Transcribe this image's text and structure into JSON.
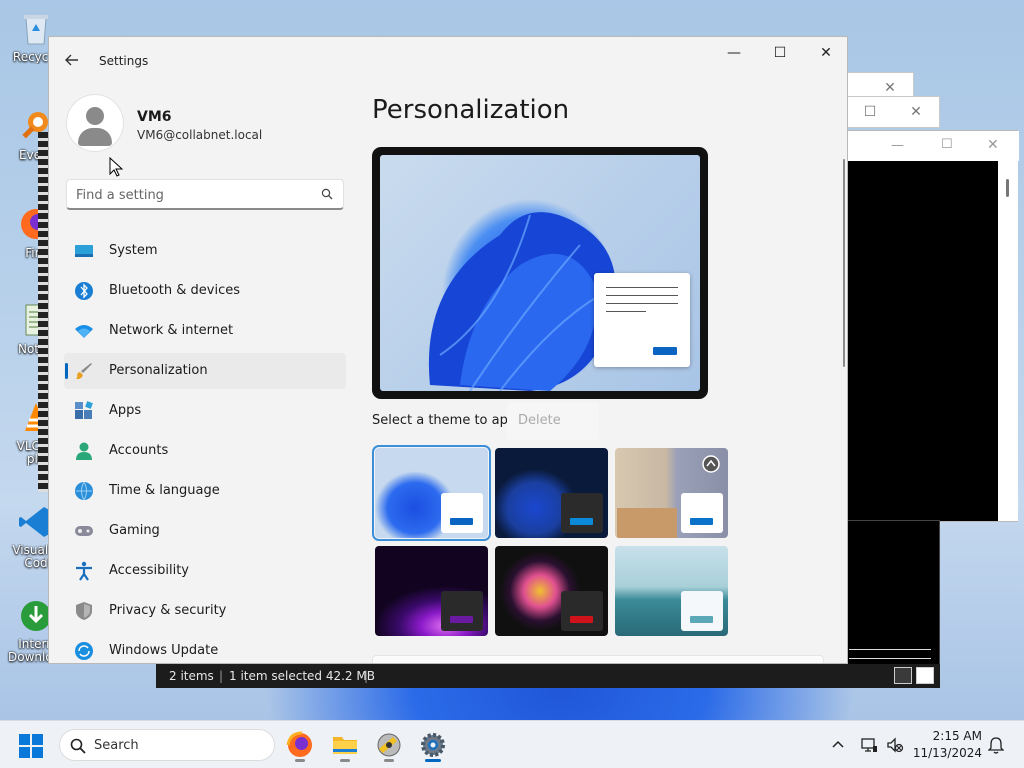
{
  "desktop": {
    "icons": [
      {
        "label": "Recycle",
        "icon": "recycle-bin-icon"
      },
      {
        "label": "Every",
        "icon": "everything-search-icon"
      },
      {
        "label": "Fire",
        "icon": "firefox-icon"
      },
      {
        "label": "Notep",
        "icon": "notepad-icon"
      },
      {
        "label": "VLC m",
        "label2": "pla",
        "icon": "vlc-icon"
      },
      {
        "label": "Visual S",
        "label2": "Cod",
        "icon": "vscode-icon"
      },
      {
        "label": "Intern",
        "label2": "Downlo...",
        "icon": "download-manager-icon"
      }
    ]
  },
  "settings": {
    "app_title": "Settings",
    "window_controls": {
      "minimize": "—",
      "maximize": "☐",
      "close": "✕"
    },
    "user": {
      "name": "VM6",
      "email": "VM6@collabnet.local"
    },
    "search": {
      "placeholder": "Find a setting"
    },
    "nav": [
      {
        "label": "System",
        "icon": "system-icon",
        "selected": false
      },
      {
        "label": "Bluetooth & devices",
        "icon": "bluetooth-icon",
        "selected": false
      },
      {
        "label": "Network & internet",
        "icon": "wifi-icon",
        "selected": false
      },
      {
        "label": "Personalization",
        "icon": "paintbrush-icon",
        "selected": true
      },
      {
        "label": "Apps",
        "icon": "apps-icon",
        "selected": false
      },
      {
        "label": "Accounts",
        "icon": "accounts-icon",
        "selected": false
      },
      {
        "label": "Time & language",
        "icon": "globe-clock-icon",
        "selected": false
      },
      {
        "label": "Gaming",
        "icon": "gamepad-icon",
        "selected": false
      },
      {
        "label": "Accessibility",
        "icon": "accessibility-icon",
        "selected": false
      },
      {
        "label": "Privacy & security",
        "icon": "shield-icon",
        "selected": false
      },
      {
        "label": "Windows Update",
        "icon": "update-icon",
        "selected": false
      }
    ],
    "page_title": "Personalization",
    "theme_label": "Select a theme to ap",
    "delete_label": "Delete",
    "themes": [
      {
        "name": "windows-light",
        "selected": true,
        "accent": "#0a64c2"
      },
      {
        "name": "windows-dark",
        "selected": false,
        "accent": "#0a8ad8"
      },
      {
        "name": "glow-photo",
        "selected": false,
        "accent": "#0a72c8"
      },
      {
        "name": "glow-purple",
        "selected": false,
        "accent": "#6a1aa0"
      },
      {
        "name": "captured-motion",
        "selected": false,
        "accent": "#d0121b"
      },
      {
        "name": "flow-lake",
        "selected": false,
        "accent": "#5aa8b8"
      }
    ]
  },
  "explorer_status": {
    "items": "2 items",
    "selected": "1 item selected  42.2 MB"
  },
  "taskbar": {
    "search_label": "Search",
    "apps": [
      {
        "name": "firefox",
        "icon": "firefox-icon",
        "active": false
      },
      {
        "name": "file-explorer",
        "icon": "folder-icon",
        "active": false
      },
      {
        "name": "disk-app",
        "icon": "disk-cleanup-icon",
        "active": false
      },
      {
        "name": "settings",
        "icon": "gear-icon",
        "active": true
      }
    ],
    "time": "2:15 AM",
    "date": "11/13/2024"
  },
  "colors": {
    "accent": "#0067c0",
    "selected_nav_bg": "#eaeaea"
  }
}
